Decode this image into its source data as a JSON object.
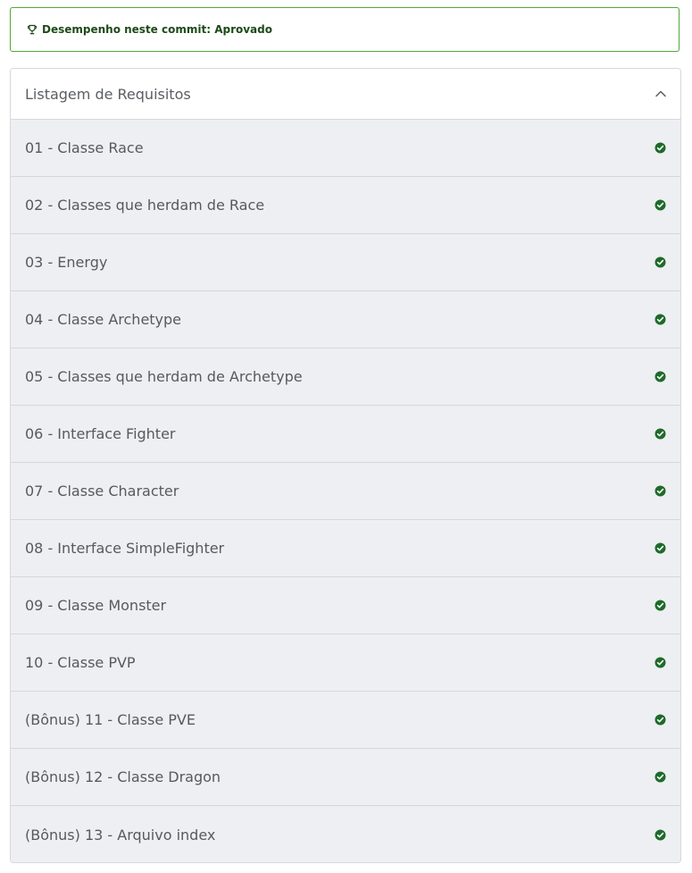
{
  "banner": {
    "icon": "trophy-icon",
    "text": "Desempenho neste commit: Aprovado",
    "color": "#1d4a18",
    "border_color": "#52a83a"
  },
  "requirements": {
    "title": "Listagem de Requisitos",
    "toggle_icon": "chevron-up-icon",
    "status_icon": "check-circle-icon",
    "status_color": "#1e6b2a",
    "items": [
      {
        "label": "01 - Classe Race"
      },
      {
        "label": "02 - Classes que herdam de Race"
      },
      {
        "label": "03 - Energy"
      },
      {
        "label": "04 - Classe Archetype"
      },
      {
        "label": "05 - Classes que herdam de Archetype"
      },
      {
        "label": "06 - Interface Fighter"
      },
      {
        "label": "07 - Classe Character"
      },
      {
        "label": "08 - Interface SimpleFighter"
      },
      {
        "label": "09 - Classe Monster"
      },
      {
        "label": "10 - Classe PVP"
      },
      {
        "label": "(Bônus) 11 - Classe PVE"
      },
      {
        "label": "(Bônus) 12 - Classe Dragon"
      },
      {
        "label": "(Bônus) 13 - Arquivo index"
      }
    ]
  }
}
